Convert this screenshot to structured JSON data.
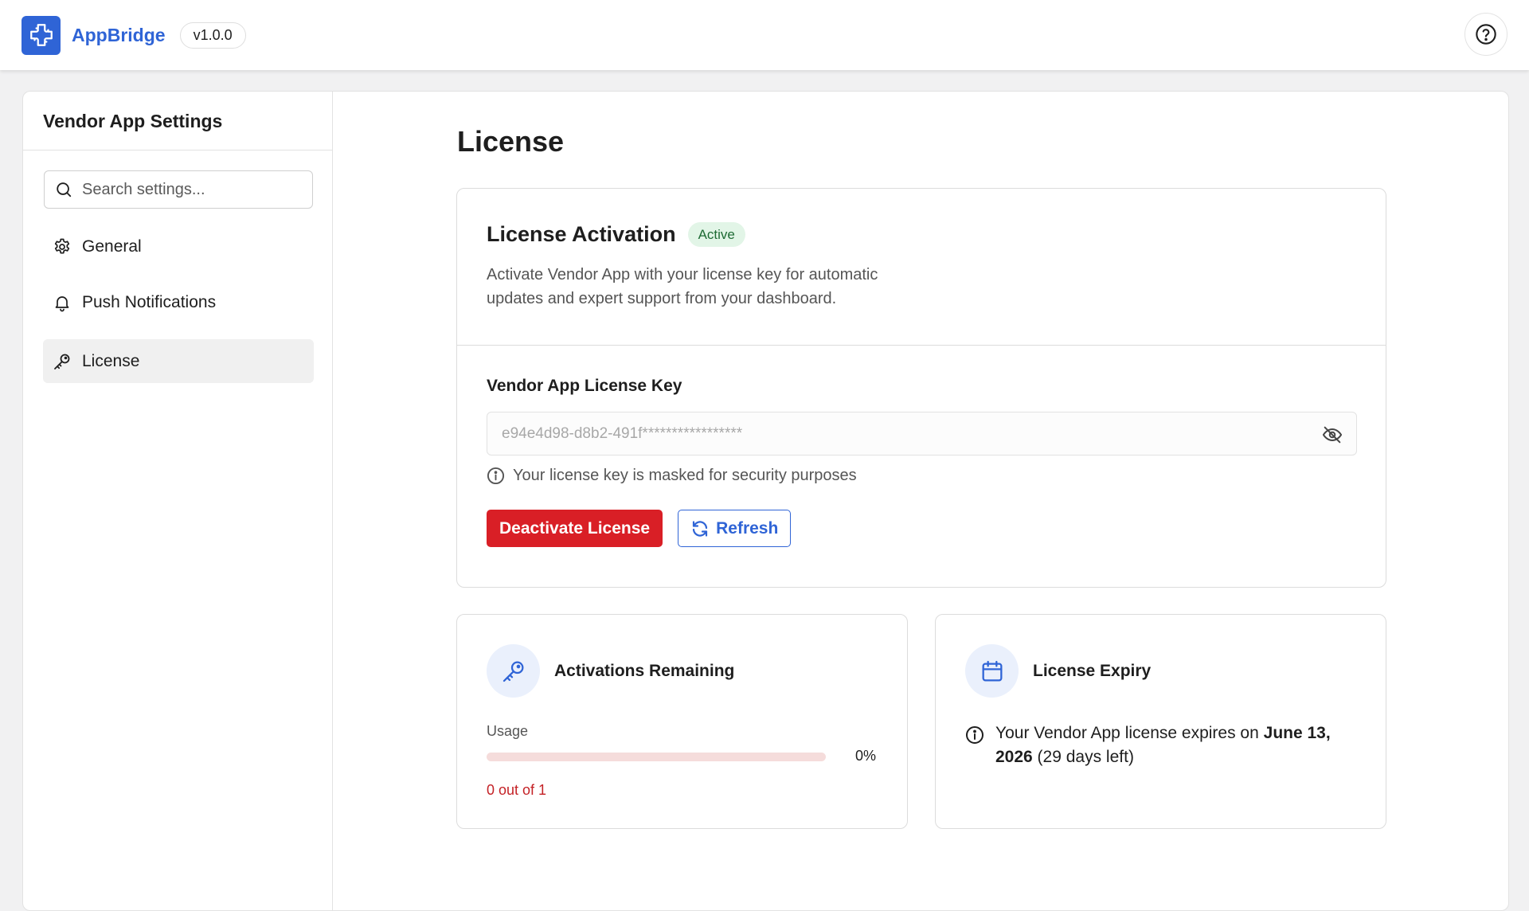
{
  "header": {
    "brand": "AppBridge",
    "version": "v1.0.0",
    "logo_icon": "puzzle-plus-icon",
    "help_icon": "help-circle-icon"
  },
  "sidebar": {
    "title": "Vendor App Settings",
    "search_placeholder": "Search settings...",
    "items": [
      {
        "label": "General",
        "icon": "gear-icon",
        "active": false
      },
      {
        "label": "Push Notifications",
        "icon": "bell-icon",
        "active": false
      },
      {
        "label": "License",
        "icon": "key-icon",
        "active": true
      }
    ]
  },
  "main": {
    "page_title": "License",
    "activation": {
      "title": "License Activation",
      "status": "Active",
      "description": "Activate Vendor App with your license key for automatic updates and expert support from your dashboard.",
      "field_label": "Vendor App License Key",
      "key_value": "e94e4d98-d8b2-491f*****************",
      "hint": "Your license key is masked for security purposes",
      "deactivate_label": "Deactivate License",
      "refresh_label": "Refresh"
    },
    "activations": {
      "title": "Activations Remaining",
      "usage_label": "Usage",
      "usage_percent": "0%",
      "usage_fraction": 0,
      "usage_count": "0 out of 1"
    },
    "expiry": {
      "title": "License Expiry",
      "text_prefix": "Your Vendor App license expires on ",
      "date": "June 13, 2026",
      "text_suffix": " (29 days left)"
    }
  },
  "colors": {
    "accent": "#2f64d6",
    "danger": "#d91f26",
    "success_bg": "#e2f5e7",
    "success_text": "#1e6b34"
  }
}
